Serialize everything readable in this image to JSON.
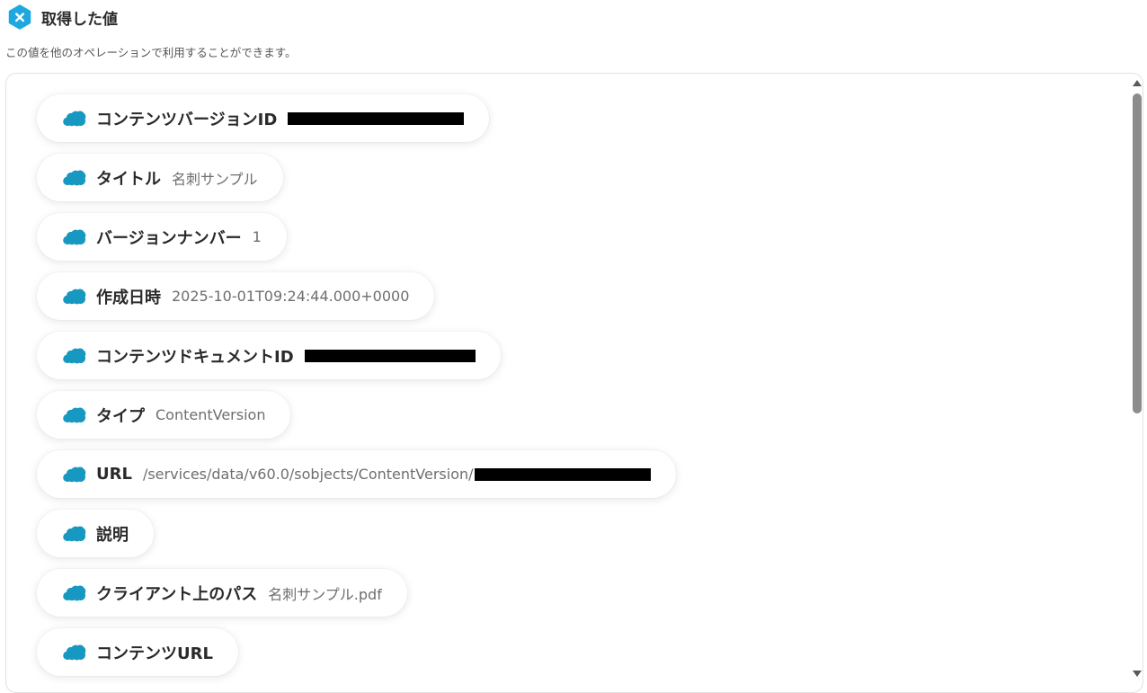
{
  "header": {
    "title": "取得した値",
    "subtitle": "この値を他のオペレーションで利用することができます。",
    "icon": "x-hexagon-icon",
    "icon_color": "#1fa8df"
  },
  "brand_color": "#1798c1",
  "items": [
    {
      "label": "コンテンツバージョンID",
      "value": "",
      "redacted": true
    },
    {
      "label": "タイトル",
      "value": "名刺サンプル"
    },
    {
      "label": "バージョンナンバー",
      "value": "1"
    },
    {
      "label": "作成日時",
      "value": "2025-10-01T09:24:44.000+0000"
    },
    {
      "label": "コンテンツドキュメントID",
      "value": "",
      "redacted": true
    },
    {
      "label": "タイプ",
      "value": "ContentVersion"
    },
    {
      "label": "URL",
      "value": "/services/data/v60.0/sobjects/ContentVersion/",
      "redacted": true
    },
    {
      "label": "説明",
      "value": ""
    },
    {
      "label": "クライアント上のパス",
      "value": "名刺サンプル.pdf"
    },
    {
      "label": "コンテンツURL",
      "value": ""
    }
  ],
  "item_icon": "salesforce-cloud-icon"
}
